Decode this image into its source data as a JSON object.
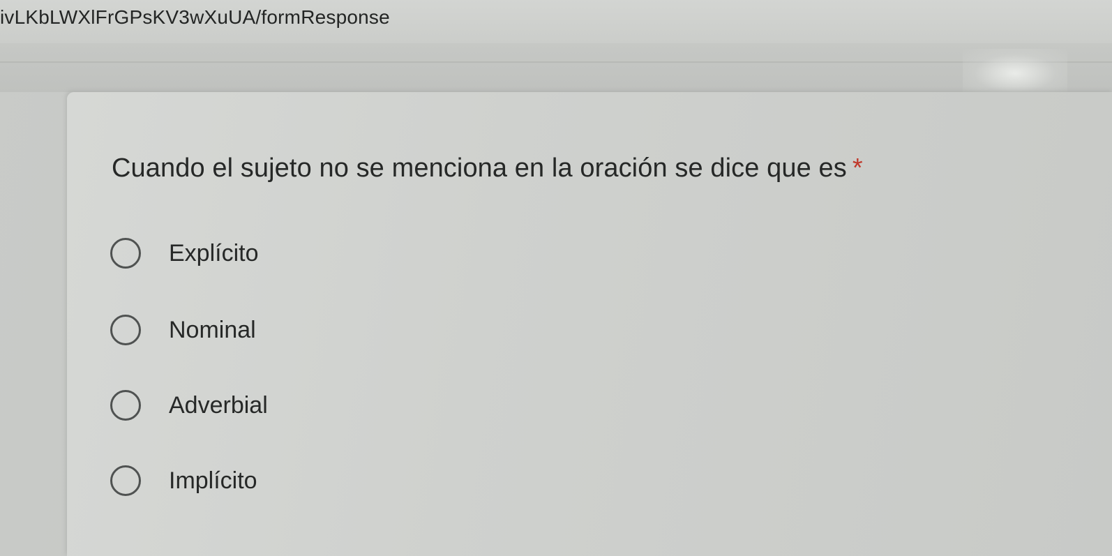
{
  "browser": {
    "url_text": "ivLKbLWXlFrGPsKV3wXuUA/formResponse"
  },
  "form": {
    "question": "Cuando el sujeto no se menciona en la oración se dice que es",
    "required_marker": "*",
    "options": [
      {
        "label": "Explícito",
        "selected": false
      },
      {
        "label": "Nominal",
        "selected": false
      },
      {
        "label": "Adverbial",
        "selected": false
      },
      {
        "label": "Implícito",
        "selected": false
      }
    ]
  },
  "colors": {
    "required": "#c0392b",
    "radio_border": "#4f5251"
  }
}
